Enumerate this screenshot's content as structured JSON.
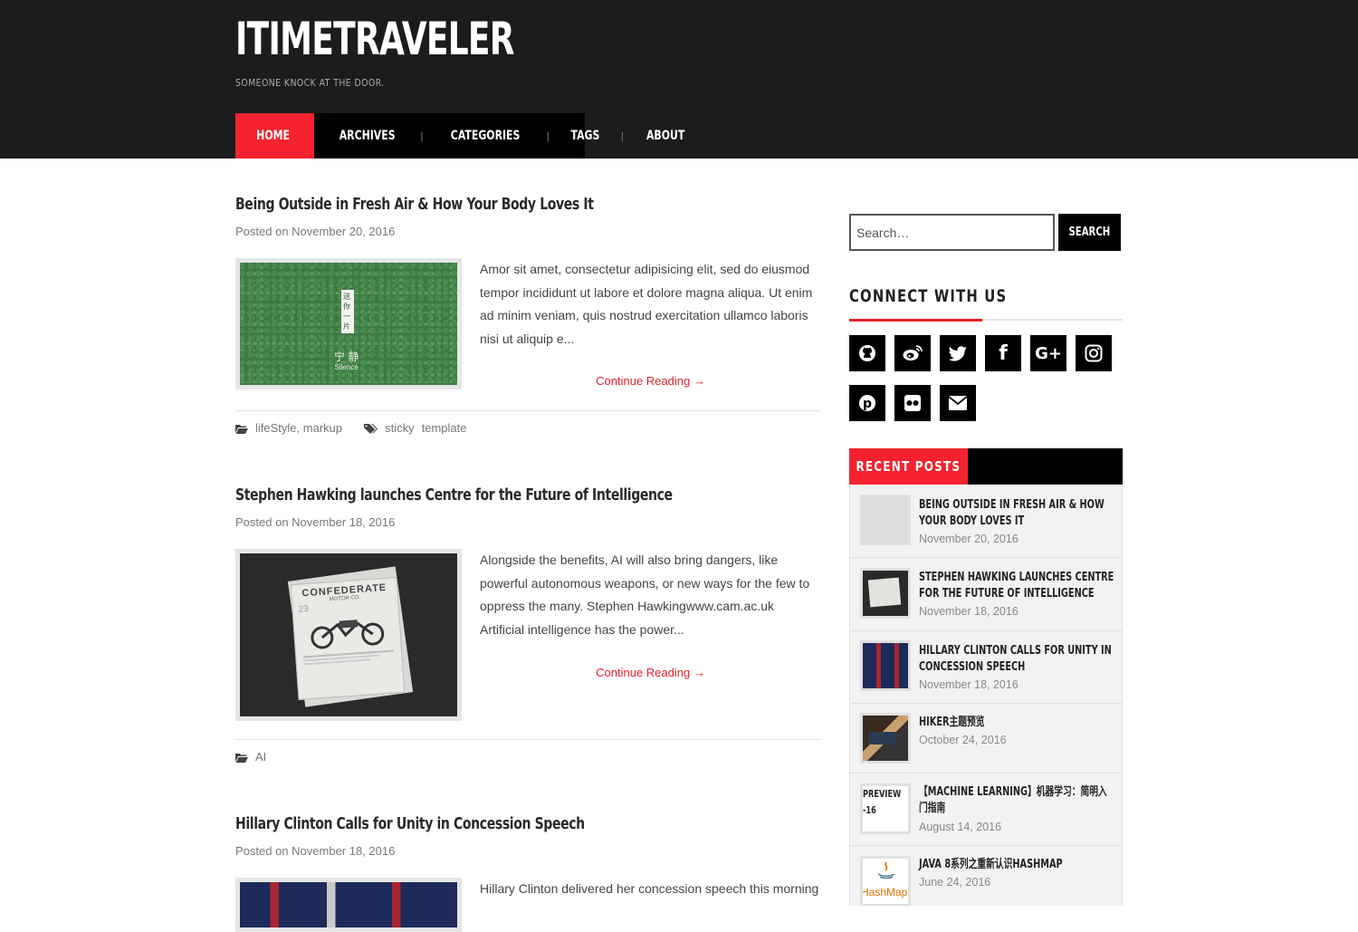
{
  "site": {
    "title": "ITIMETRAVELER",
    "tagline": "SOMEONE KNOCK AT THE DOOR."
  },
  "nav": {
    "items": [
      {
        "label": "HOME",
        "active": true
      },
      {
        "label": "ARCHIVES"
      },
      {
        "label": "CATEGORIES"
      },
      {
        "label": "TAGS"
      },
      {
        "label": "ABOUT"
      }
    ],
    "separator": "|"
  },
  "posts": [
    {
      "title": "Being Outside in Fresh Air & How Your Body Loves It",
      "date": "Posted on November 20, 2016",
      "excerpt": "Amor sit amet, consectetur adipisicing elit, sed do eiusmod tempor incididunt ut labore et dolore magna aliqua. Ut enim ad minim veniam, quis nostrud exercitation ullamco laboris nisi ut aliquip e...",
      "continue": "Continue Reading →",
      "categories": [
        "lifeStyle",
        "markup"
      ],
      "category_separator": ",",
      "tags": [
        "sticky",
        "template"
      ],
      "thumb_vertical_text": "送你一片",
      "thumb_caption": "宁 静",
      "thumb_caption_en": "Silence"
    },
    {
      "title": "Stephen Hawking launches Centre for the Future of Intelligence",
      "date": "Posted on November 18, 2016",
      "excerpt": "Alongside the benefits, AI will also bring dangers, like powerful autonomous weapons, or new ways for the few to oppress the many. Stephen Hawkingwww.cam.ac.uk Artificial intelligence has the power...",
      "continue": "Continue Reading →",
      "categories": [
        "AI"
      ],
      "tags": [],
      "thumb_paper_title": "CONFEDERATE",
      "thumb_paper_sub": "MOTOR CO.",
      "thumb_paper_num": "23"
    },
    {
      "title": "Hillary Clinton Calls for Unity in Concession Speech",
      "date": "Posted on November 18, 2016",
      "excerpt": "Hillary Clinton delivered her concession speech this morning"
    }
  ],
  "sidebar": {
    "search": {
      "placeholder": "Search…",
      "button": "SEARCH"
    },
    "connect_title": "CONNECT WITH US",
    "social": [
      {
        "icon": "github-icon"
      },
      {
        "icon": "weibo-icon"
      },
      {
        "icon": "twitter-icon"
      },
      {
        "icon": "facebook-icon",
        "glyph": "f"
      },
      {
        "icon": "google-plus-icon",
        "glyph": "G+"
      },
      {
        "icon": "instagram-icon"
      },
      {
        "icon": "pinterest-icon",
        "glyph": "p"
      },
      {
        "icon": "flickr-icon"
      },
      {
        "icon": "envelope-icon"
      }
    ],
    "recent_title": "RECENT POSTS",
    "recent": [
      {
        "title": "BEING OUTSIDE IN FRESH AIR & HOW YOUR BODY LOVES IT",
        "date": "November 20, 2016"
      },
      {
        "title": "STEPHEN HAWKING LAUNCHES CENTRE FOR THE FUTURE OF INTELLIGENCE",
        "date": "November 18, 2016"
      },
      {
        "title": "HILLARY CLINTON CALLS FOR UNITY IN CONCESSION SPEECH",
        "date": "November 18, 2016"
      },
      {
        "title": "HIKER主题预览",
        "date": "October 24, 2016"
      },
      {
        "title": "【MACHINE LEARNING】机器学习：简明入门指南",
        "date": "August 14, 2016",
        "thumb_alt": "PREVIEW-16"
      },
      {
        "title": "JAVA 8系列之重新认识HASHMAP",
        "date": "June 24, 2016",
        "thumb_alt": "HashMap"
      }
    ]
  },
  "colors": {
    "header_bg": "#1c1c1f",
    "accent": "#f5232f",
    "link_red": "#e5222c",
    "nav_bg": "#000000"
  }
}
